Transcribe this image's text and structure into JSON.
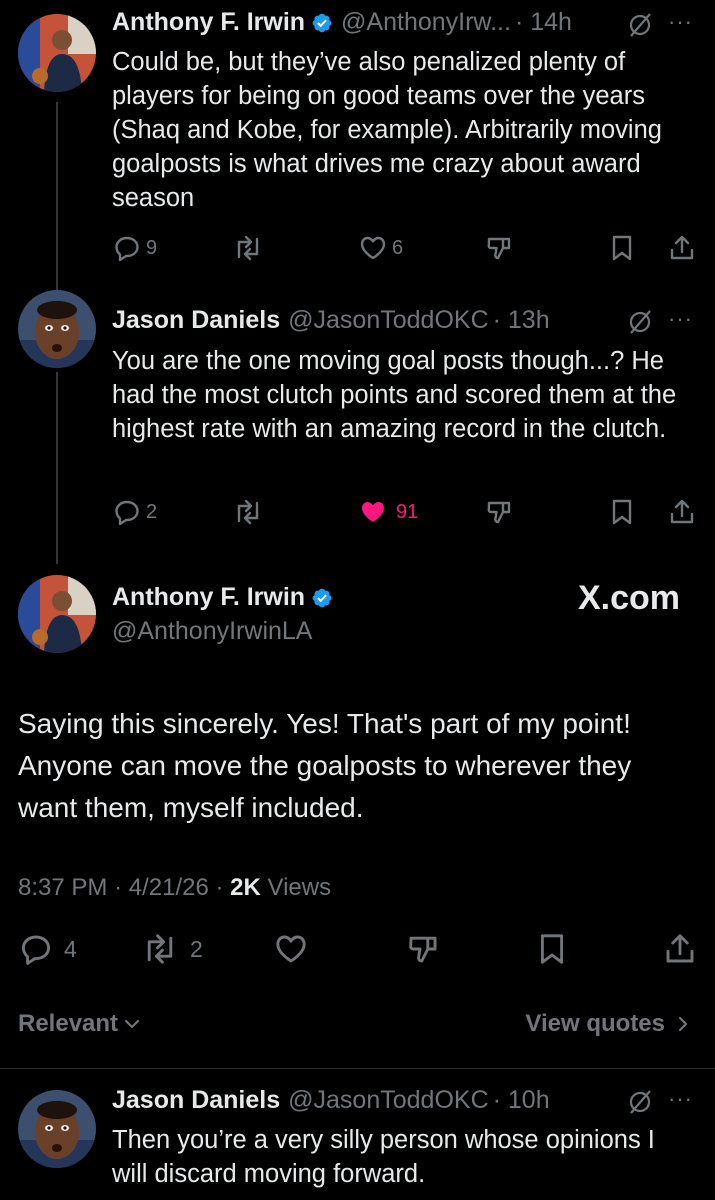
{
  "reply1": {
    "name": "Anthony F. Irwin",
    "handle": "@AnthonyIrw...",
    "time": "· 14h",
    "text": "Could be, but they’ve also penalized plenty of players for being on good teams over the years (Shaq and Kobe, for example). Arbitrarily moving goalposts is what drives me crazy about award season",
    "replies": "9",
    "likes": "6"
  },
  "reply2": {
    "name": "Jason Daniels",
    "handle": "@JasonToddOKC",
    "time": "· 13h",
    "text": "You are the one moving goal posts though...? He had the most clutch points and scored them at the highest rate with an amazing record in the clutch.",
    "replies": "2",
    "likes": "91"
  },
  "main": {
    "name": "Anthony F. Irwin",
    "handle": "@AnthonyIrwinLA",
    "watermark": "X.com",
    "text": "Saying this sincerely. Yes! That's part of my point! Anyone can move the goalposts to wherever they want them, myself included.",
    "time": "8:37 PM",
    "date": "4/21/26",
    "views_count": "2K",
    "views_label": "Views",
    "replies": "4",
    "reposts": "2"
  },
  "sort": {
    "label": "Relevant",
    "view_quotes": "View quotes"
  },
  "reply3": {
    "name": "Jason Daniels",
    "handle": "@JasonToddOKC",
    "time": "· 10h",
    "text": "Then you’re a very silly person whose opinions I will discard moving forward."
  },
  "colors": {
    "background": "#000000",
    "text": "#e7e9ea",
    "secondary": "#71767b",
    "verified": "#1d9bf0",
    "like_active": "#f91880"
  },
  "icons": [
    "verified-icon",
    "grok-icon",
    "more-icon",
    "reply-icon",
    "repost-icon",
    "like-icon",
    "dislike-icon",
    "bookmark-icon",
    "share-icon",
    "chevron-down-icon",
    "chevron-right-icon"
  ]
}
